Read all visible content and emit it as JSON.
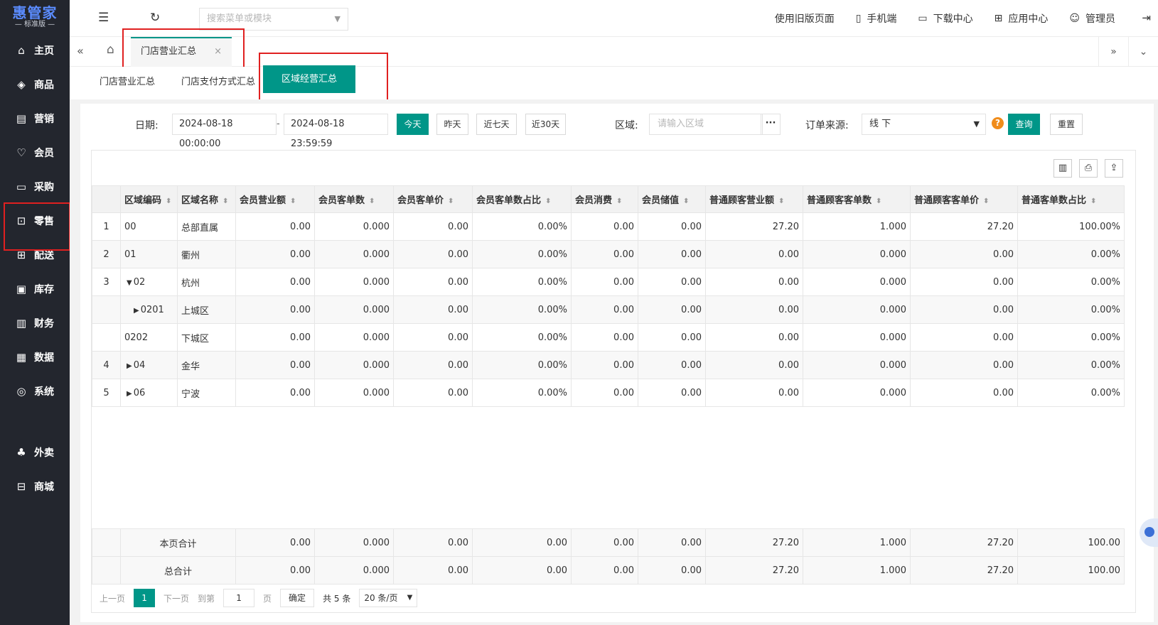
{
  "logo": {
    "main": "惠管家",
    "sub": "— 标准版 —"
  },
  "sidebar": {
    "items": [
      {
        "label": "主页",
        "icon": "⌂"
      },
      {
        "label": "商品",
        "icon": "◈"
      },
      {
        "label": "营销",
        "icon": "▤"
      },
      {
        "label": "会员",
        "icon": "♡"
      },
      {
        "label": "采购",
        "icon": "▭"
      },
      {
        "label": "零售",
        "icon": "⊡"
      },
      {
        "label": "配送",
        "icon": "⊞"
      },
      {
        "label": "库存",
        "icon": "▣"
      },
      {
        "label": "财务",
        "icon": "▥"
      },
      {
        "label": "数据",
        "icon": "▦"
      },
      {
        "label": "系统",
        "icon": "◎"
      },
      {
        "label": "外卖",
        "icon": "♣"
      },
      {
        "label": "商城",
        "icon": "⊟"
      }
    ]
  },
  "topbar": {
    "search_placeholder": "搜索菜单或模块",
    "links": [
      {
        "label": "使用旧版页面",
        "icon": ""
      },
      {
        "label": "手机端",
        "icon": "▯"
      },
      {
        "label": "下载中心",
        "icon": "▭"
      },
      {
        "label": "应用中心",
        "icon": "⊞"
      },
      {
        "label": "管理员",
        "icon": "☺"
      }
    ]
  },
  "tabs": {
    "active": "门店营业汇总",
    "close": "×"
  },
  "subtabs": [
    "门店营业汇总",
    "门店支付方式汇总",
    "区域经营汇总"
  ],
  "filter": {
    "date_label": "日期:",
    "date_start": "2024-08-18 00:00:00",
    "date_end": "2024-08-18 23:59:59",
    "dash": "-",
    "btn_today": "今天",
    "btn_yesterday": "昨天",
    "btn_7days": "近七天",
    "btn_30days": "近30天",
    "region_label": "区域:",
    "region_placeholder": "请输入区域",
    "region_more": "···",
    "source_label": "订单来源:",
    "source_value": "线 下",
    "help": "?",
    "btn_query": "查询",
    "btn_reset": "重置"
  },
  "table": {
    "headers": [
      "区域编码",
      "区域名称",
      "会员营业额",
      "会员客单数",
      "会员客单价",
      "会员客单数占比",
      "会员消费",
      "会员储值",
      "普通顾客营业额",
      "普通顾客客单数",
      "普通顾客客单价",
      "普通客单数占比"
    ],
    "rows": [
      {
        "idx": "1",
        "code": "00",
        "toggle": "",
        "name": "总部直属",
        "v": [
          "0.00",
          "0.000",
          "0.00",
          "0.00%",
          "0.00",
          "0.00",
          "27.20",
          "1.000",
          "27.20",
          "100.00%"
        ]
      },
      {
        "idx": "2",
        "code": "01",
        "toggle": "",
        "name": "衢州",
        "v": [
          "0.00",
          "0.000",
          "0.00",
          "0.00%",
          "0.00",
          "0.00",
          "0.00",
          "0.000",
          "0.00",
          "0.00%"
        ]
      },
      {
        "idx": "3",
        "code": "02",
        "toggle": "▼",
        "name": "杭州",
        "v": [
          "0.00",
          "0.000",
          "0.00",
          "0.00%",
          "0.00",
          "0.00",
          "0.00",
          "0.000",
          "0.00",
          "0.00%"
        ]
      },
      {
        "idx": "",
        "code": "0201",
        "toggle": "▶",
        "name": "上城区",
        "v": [
          "0.00",
          "0.000",
          "0.00",
          "0.00%",
          "0.00",
          "0.00",
          "0.00",
          "0.000",
          "0.00",
          "0.00%"
        ]
      },
      {
        "idx": "",
        "code": "0202",
        "toggle": "",
        "name": "下城区",
        "v": [
          "0.00",
          "0.000",
          "0.00",
          "0.00%",
          "0.00",
          "0.00",
          "0.00",
          "0.000",
          "0.00",
          "0.00%"
        ]
      },
      {
        "idx": "4",
        "code": "04",
        "toggle": "▶",
        "name": "金华",
        "v": [
          "0.00",
          "0.000",
          "0.00",
          "0.00%",
          "0.00",
          "0.00",
          "0.00",
          "0.000",
          "0.00",
          "0.00%"
        ]
      },
      {
        "idx": "5",
        "code": "06",
        "toggle": "▶",
        "name": "宁波",
        "v": [
          "0.00",
          "0.000",
          "0.00",
          "0.00%",
          "0.00",
          "0.00",
          "0.00",
          "0.000",
          "0.00",
          "0.00%"
        ]
      }
    ],
    "footer": [
      {
        "label": "本页合计",
        "v": [
          "0.00",
          "0.000",
          "0.00",
          "0.00",
          "0.00",
          "0.00",
          "27.20",
          "1.000",
          "27.20",
          "100.00"
        ]
      },
      {
        "label": "总合计",
        "v": [
          "0.00",
          "0.000",
          "0.00",
          "0.00",
          "0.00",
          "0.00",
          "27.20",
          "1.000",
          "27.20",
          "100.00"
        ]
      }
    ]
  },
  "pager": {
    "prev": "上一页",
    "current": "1",
    "next": "下一页",
    "goto": "到第",
    "page_input": "1",
    "page_unit": "页",
    "confirm": "确定",
    "total": "共 5 条",
    "page_size": "20 条/页"
  },
  "colors": {
    "primary": "#009688",
    "sidebar": "#23262e",
    "highlight": "#e02020"
  }
}
